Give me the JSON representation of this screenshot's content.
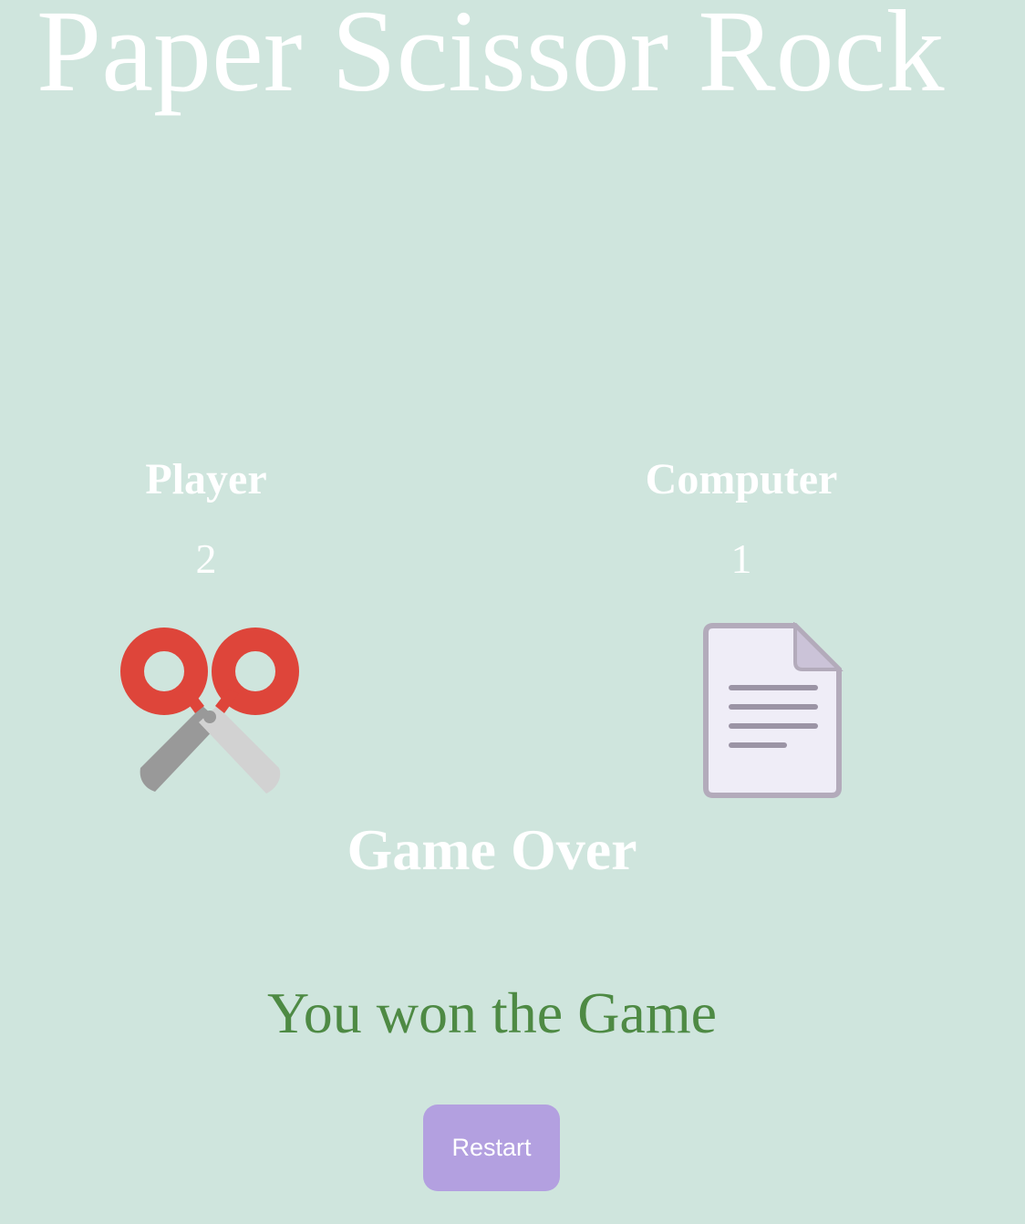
{
  "header": {
    "title": "Paper Scissor Rock"
  },
  "player": {
    "label": "Player",
    "score": "2",
    "choice_icon": "scissors-icon"
  },
  "computer": {
    "label": "Computer",
    "score": "1",
    "choice_icon": "paper-document-icon"
  },
  "status": {
    "game_over_text": "Game Over",
    "result_text": "You won the Game",
    "result_color": "#4e8a44"
  },
  "controls": {
    "restart_label": "Restart",
    "restart_color": "#b3a0e0"
  },
  "colors": {
    "background": "#cfe5dd",
    "text": "#ffffff"
  }
}
